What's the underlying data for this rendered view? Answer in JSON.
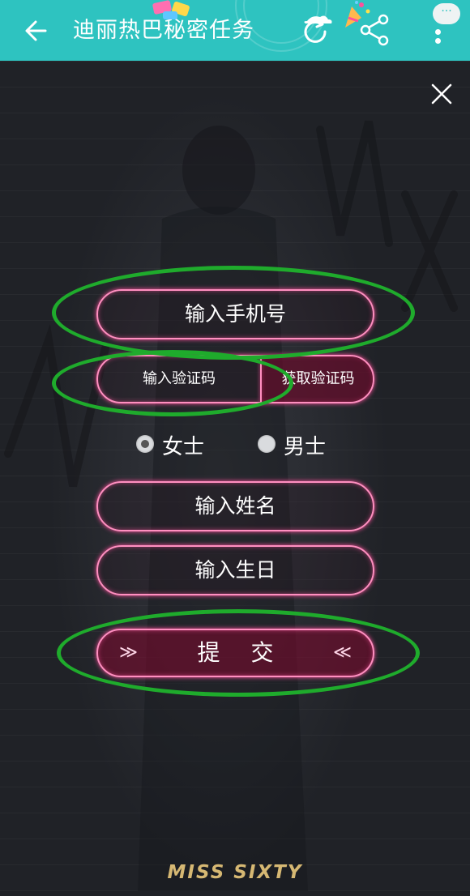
{
  "app_bar": {
    "title": "迪丽热巴秘密任务",
    "message_badge": "···",
    "background_color": "#2ec3c0"
  },
  "icons": {
    "back": "back-arrow-icon",
    "refresh": "refresh-icon",
    "share": "share-icon",
    "more": "more-vertical-icon",
    "close": "close-icon"
  },
  "form": {
    "phone_placeholder": "输入手机号",
    "code_placeholder": "输入验证码",
    "get_code_label": "获取验证码",
    "gender": {
      "female_label": "女士",
      "male_label": "男士",
      "selected": "女士"
    },
    "name_placeholder": "输入姓名",
    "birthday_placeholder": "输入生日",
    "submit_label": "提交",
    "submit_arrow_left": "≫",
    "submit_arrow_right": "≪"
  },
  "brand": {
    "logo_text": "MISS SIXTY"
  },
  "colors": {
    "neon_border": "#ff8fc0",
    "highlight_annotation": "#1fab2c",
    "brand_gold": "#d6b873"
  }
}
